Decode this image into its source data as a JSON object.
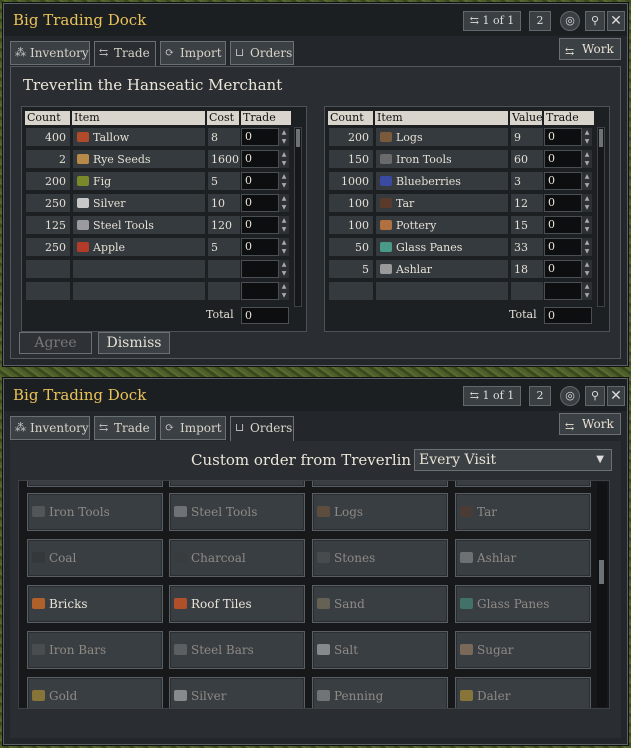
{
  "window1": {
    "title": "Big Trading Dock",
    "page_indicator": "1 of 1",
    "count_field": "2",
    "tabs": [
      {
        "label": "Inventory",
        "icon": "inventory-icon"
      },
      {
        "label": "Trade",
        "icon": "trade-icon"
      },
      {
        "label": "Import",
        "icon": "import-icon"
      },
      {
        "label": "Orders",
        "icon": "cart-icon"
      }
    ],
    "active_tab": "Trade",
    "work_label": "Work",
    "merchant_name": "Treverlin the Hanseatic Merchant",
    "sell_table": {
      "headers": [
        "Count",
        "Item",
        "Cost",
        "Trade"
      ],
      "rows": [
        {
          "count": "400",
          "item": "Tallow",
          "icon_color": "#b04a2a",
          "cost": "8",
          "trade": "0"
        },
        {
          "count": "2",
          "item": "Rye Seeds",
          "icon_color": "#b88a4a",
          "cost": "1600",
          "trade": "0"
        },
        {
          "count": "200",
          "item": "Fig",
          "icon_color": "#7a8a2a",
          "cost": "5",
          "trade": "0"
        },
        {
          "count": "250",
          "item": "Silver",
          "icon_color": "#c8c8c8",
          "cost": "10",
          "trade": "0"
        },
        {
          "count": "125",
          "item": "Steel Tools",
          "icon_color": "#9a9aa0",
          "cost": "120",
          "trade": "0"
        },
        {
          "count": "250",
          "item": "Apple",
          "icon_color": "#b43a2a",
          "cost": "5",
          "trade": "0"
        }
      ],
      "total_label": "Total",
      "total": "0"
    },
    "buy_table": {
      "headers": [
        "Count",
        "Item",
        "Value",
        "Trade"
      ],
      "rows": [
        {
          "count": "200",
          "item": "Logs",
          "icon_color": "#7a5a3a",
          "value": "9",
          "trade": "0"
        },
        {
          "count": "150",
          "item": "Iron Tools",
          "icon_color": "#6a6a6a",
          "value": "60",
          "trade": "0"
        },
        {
          "count": "1000",
          "item": "Blueberries",
          "icon_color": "#3a4aa0",
          "value": "3",
          "trade": "0"
        },
        {
          "count": "100",
          "item": "Tar",
          "icon_color": "#5a3a2a",
          "value": "12",
          "trade": "0"
        },
        {
          "count": "100",
          "item": "Pottery",
          "icon_color": "#b07040",
          "value": "15",
          "trade": "0"
        },
        {
          "count": "50",
          "item": "Glass Panes",
          "icon_color": "#4a9a8a",
          "value": "33",
          "trade": "0"
        },
        {
          "count": "5",
          "item": "Ashlar",
          "icon_color": "#9a9a9a",
          "value": "18",
          "trade": "0"
        }
      ],
      "total_label": "Total",
      "total": "0"
    },
    "agree_label": "Agree",
    "dismiss_label": "Dismiss"
  },
  "window2": {
    "title": "Big Trading Dock",
    "page_indicator": "1 of 1",
    "count_field": "2",
    "tabs": [
      {
        "label": "Inventory",
        "icon": "inventory-icon"
      },
      {
        "label": "Trade",
        "icon": "trade-icon"
      },
      {
        "label": "Import",
        "icon": "import-icon"
      },
      {
        "label": "Orders",
        "icon": "cart-icon"
      }
    ],
    "active_tab": "Orders",
    "work_label": "Work",
    "order_header": "Custom order from Treverlin",
    "frequency": "Every Visit",
    "goods": [
      {
        "label": "Iron Tools",
        "enabled": false,
        "icon_color": "#6a6a6a"
      },
      {
        "label": "Steel Tools",
        "enabled": false,
        "icon_color": "#9a9aa0"
      },
      {
        "label": "Logs",
        "enabled": false,
        "icon_color": "#7a5a3a"
      },
      {
        "label": "Tar",
        "enabled": false,
        "icon_color": "#5a3a2a"
      },
      {
        "label": "Coal",
        "enabled": false,
        "icon_color": "#333333"
      },
      {
        "label": "Charcoal",
        "enabled": false,
        "icon_color": "#3a3a3a"
      },
      {
        "label": "Stones",
        "enabled": false,
        "icon_color": "#555555"
      },
      {
        "label": "Ashlar",
        "enabled": false,
        "icon_color": "#9a9a9a"
      },
      {
        "label": "Bricks",
        "enabled": true,
        "icon_color": "#b0602a"
      },
      {
        "label": "Roof Tiles",
        "enabled": true,
        "icon_color": "#b0502a"
      },
      {
        "label": "Sand",
        "enabled": false,
        "icon_color": "#8a8060"
      },
      {
        "label": "Glass Panes",
        "enabled": false,
        "icon_color": "#4a9a8a"
      },
      {
        "label": "Iron Bars",
        "enabled": false,
        "icon_color": "#5a5a5a"
      },
      {
        "label": "Steel Bars",
        "enabled": false,
        "icon_color": "#7a7a7a"
      },
      {
        "label": "Salt",
        "enabled": false,
        "icon_color": "#c8c8c8"
      },
      {
        "label": "Sugar",
        "enabled": false,
        "icon_color": "#b08a6a"
      },
      {
        "label": "Gold",
        "enabled": false,
        "icon_color": "#c8a030"
      },
      {
        "label": "Silver",
        "enabled": false,
        "icon_color": "#c8c8c8"
      },
      {
        "label": "Penning",
        "enabled": false,
        "icon_color": "#a0a0a0"
      },
      {
        "label": "Daler",
        "enabled": false,
        "icon_color": "#c8a030"
      }
    ]
  }
}
